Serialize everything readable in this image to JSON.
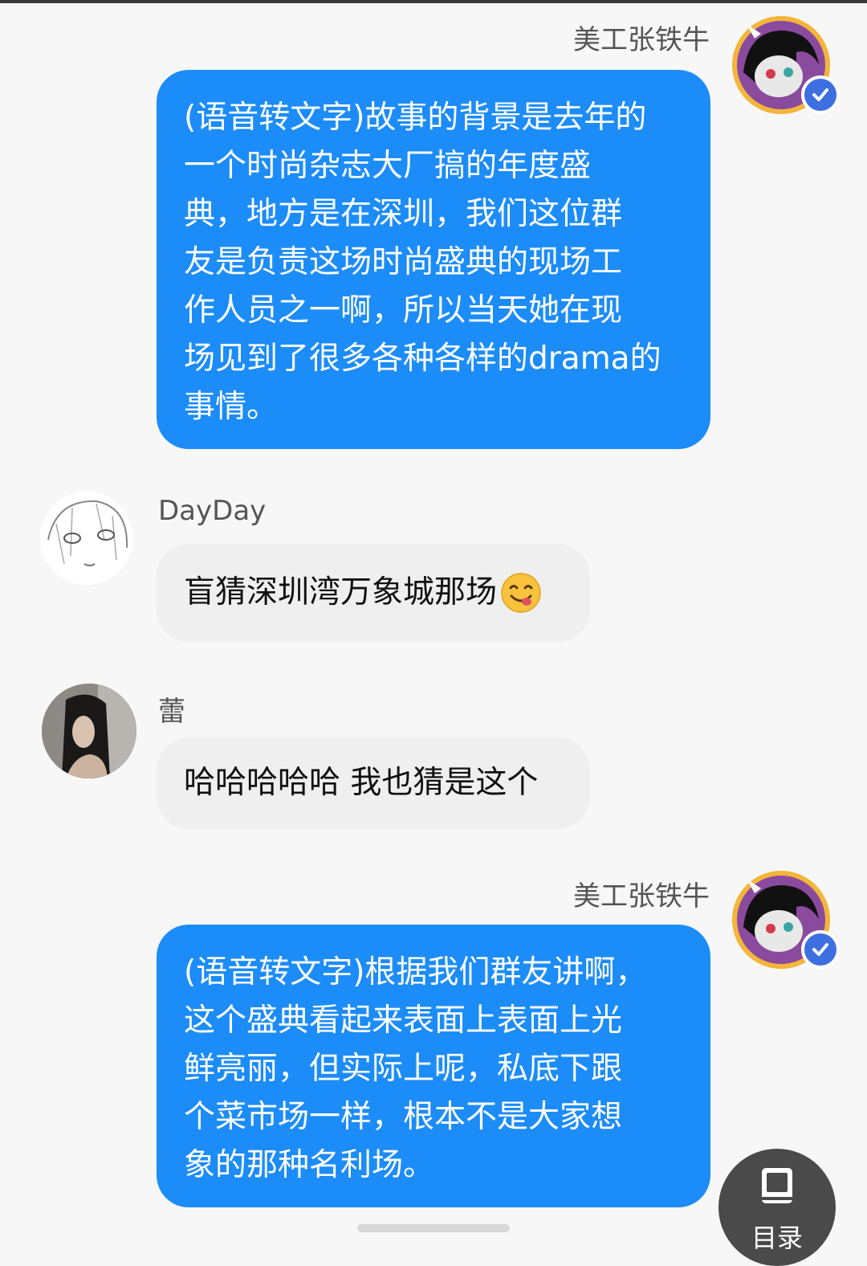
{
  "messages": [
    {
      "sender": "美工张铁牛",
      "side": "right",
      "text": "(语音转文字)故事的背景是去年的\n一个时尚杂志大厂搞的年度盛\n典，地方是在深圳，我们这位群\n友是负责这场时尚盛典的现场工\n作人员之一啊，所以当天她在现\n场见到了很多各种各样的drama的\n事情。"
    },
    {
      "sender": "DayDay",
      "side": "left",
      "text": "盲猜深圳湾万象城那场",
      "emoji": "yum-face-emoji"
    },
    {
      "sender": "蕾",
      "side": "left",
      "text": "哈哈哈哈哈 我也猜是这个"
    },
    {
      "sender": "美工张铁牛",
      "side": "right",
      "text": "(语音转文字)根据我们群友讲啊，\n这个盛典看起来表面上表面上光\n鲜亮丽，但实际上呢，私底下跟\n个菜市场一样，根本不是大家想\n象的那种名利场。"
    }
  ],
  "fab": {
    "label": "目录",
    "icon": "book-icon"
  },
  "colors": {
    "my_bubble": "#1c8cf8",
    "other_bubble": "#efefef",
    "background": "#f7f7f7",
    "verified_badge": "#3d6fe0"
  }
}
